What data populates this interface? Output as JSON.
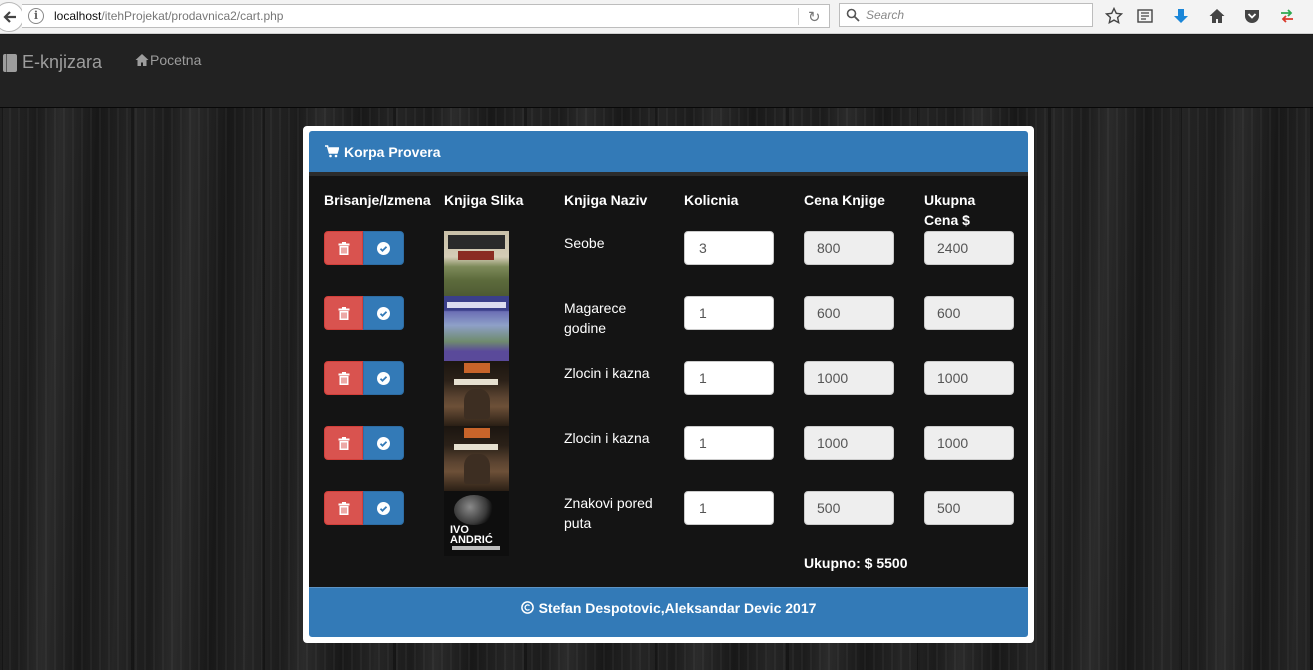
{
  "browser": {
    "url_host": "localhost",
    "url_path": "/itehProjekat/prodavnica2/cart.php",
    "search_placeholder": "Search"
  },
  "nav": {
    "brand": "E-knjizara",
    "home_label": "Pocetna"
  },
  "cart": {
    "title": "Korpa Provera",
    "columns": {
      "actions": "Brisanje/Izmena",
      "image": "Knjiga Slika",
      "name": "Knjiga Naziv",
      "quantity": "Kolicnia",
      "price": "Cena Knjige",
      "total": "Ukupna Cena $"
    },
    "items": [
      {
        "name": "Seobe",
        "quantity": "3",
        "price": "800",
        "total": "2400",
        "cover_lines": [
          "ЦРЊАНСКИ",
          "СЕОБЕ"
        ]
      },
      {
        "name": "Magarece godine",
        "quantity": "1",
        "price": "600",
        "total": "600",
        "cover_lines": [
          "МАГАРЕЋЕ ГОДИНЕ"
        ]
      },
      {
        "name": "Zlocin i kazna",
        "quantity": "1",
        "price": "1000",
        "total": "1000",
        "cover_lines": [
          "Zločin i kazna"
        ]
      },
      {
        "name": "Zlocin i kazna",
        "quantity": "1",
        "price": "1000",
        "total": "1000",
        "cover_lines": [
          "Zločin i kazna"
        ]
      },
      {
        "name": "Znakovi pored puta",
        "quantity": "1",
        "price": "500",
        "total": "500",
        "cover_lines": [
          "IVO",
          "ANDRIĆ",
          "Znakovi pored puta"
        ]
      }
    ],
    "grand_total": "Ukupno: $ 5500"
  },
  "footer": {
    "text": "Stefan Despotovic,Aleksandar Devic 2017"
  },
  "colors": {
    "primary": "#337ab7",
    "danger": "#d9534f",
    "navbar": "#222222"
  },
  "icons": [
    "back-arrow-icon",
    "info-icon",
    "reload-icon",
    "search-icon",
    "star-icon",
    "reading-list-icon",
    "download-icon",
    "home-icon",
    "pocket-icon",
    "sync-icon",
    "book-icon",
    "cart-icon",
    "trash-icon",
    "check-circle-icon",
    "copyright-icon"
  ]
}
